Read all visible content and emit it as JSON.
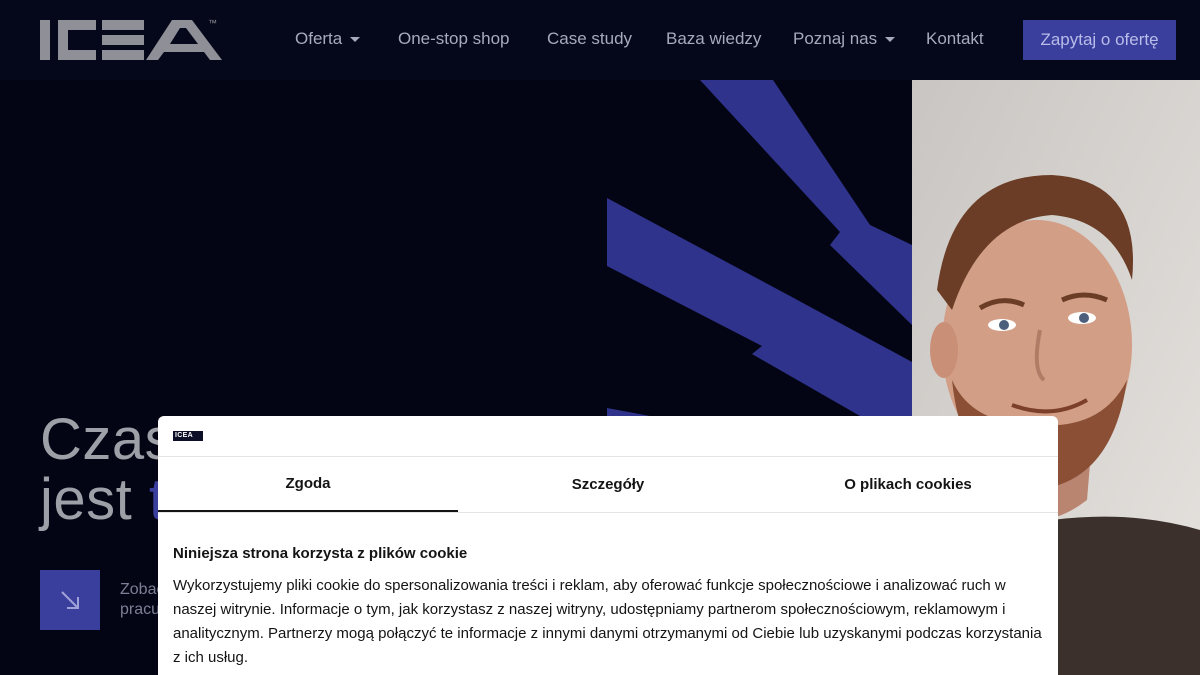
{
  "header": {
    "logo_text": "ICEA",
    "logo_tm": "™",
    "nav": [
      {
        "label": "Oferta",
        "has_dropdown": true
      },
      {
        "label": "One-stop shop",
        "has_dropdown": false
      },
      {
        "label": "Case study",
        "has_dropdown": false
      },
      {
        "label": "Baza wiedzy",
        "has_dropdown": false
      },
      {
        "label": "Poznaj nas",
        "has_dropdown": true
      },
      {
        "label": "Kontakt",
        "has_dropdown": false
      }
    ],
    "cta_label": "Zapytaj o ofertę"
  },
  "hero": {
    "title_line1": "Czas",
    "title_line2": "jest",
    "title_accent": "t",
    "link_line1": "Zobac",
    "link_line2": "pracu",
    "arrow_icon": "arrow-down-right-icon"
  },
  "cookie_dialog": {
    "logo_text": "ICEA",
    "tabs": [
      {
        "label": "Zgoda",
        "active": true
      },
      {
        "label": "Szczegóły",
        "active": false
      },
      {
        "label": "O plikach cookies",
        "active": false
      }
    ],
    "heading": "Niniejsza strona korzysta z plików cookie",
    "body": "Wykorzystujemy pliki cookie do spersonalizowania treści i reklam, aby oferować funkcje społecznościowe i analizować ruch w naszej witrynie. Informacje o tym, jak korzystasz z naszej witryny, udostępniamy partnerom społecznościowym, reklamowym i analitycznym. Partnerzy mogą połączyć te informacje z innymi danymi otrzymanymi od Ciebie lub uzyskanymi podczas korzystania z ich usług."
  },
  "colors": {
    "background": "#040514",
    "header": "#05071a",
    "accent": "#3a3f9e",
    "nav_text": "#a7a9bd"
  }
}
